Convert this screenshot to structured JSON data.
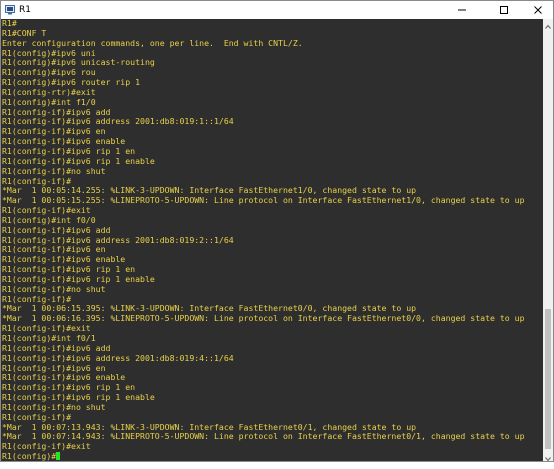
{
  "window": {
    "title": "R1"
  },
  "terminal": {
    "lines": [
      "R1#",
      "R1#CONF T",
      "Enter configuration commands, one per line.  End with CNTL/Z.",
      "R1(config)#ipv6 uni",
      "R1(config)#ipv6 unicast-routing",
      "R1(config)#ipv6 rou",
      "R1(config)#ipv6 router rip 1",
      "R1(config-rtr)#exit",
      "R1(config)#int f1/0",
      "R1(config-if)#ipv6 add",
      "R1(config-if)#ipv6 address 2001:db8:019:1::1/64",
      "R1(config-if)#ipv6 en",
      "R1(config-if)#ipv6 enable",
      "R1(config-if)#ipv6 rip 1 en",
      "R1(config-if)#ipv6 rip 1 enable",
      "R1(config-if)#no shut",
      "R1(config-if)#",
      "*Mar  1 00:05:14.255: %LINK-3-UPDOWN: Interface FastEthernet1/0, changed state to up",
      "*Mar  1 00:05:15.255: %LINEPROTO-5-UPDOWN: Line protocol on Interface FastEthernet1/0, changed state to up",
      "R1(config-if)#exit",
      "R1(config)#int f0/0",
      "R1(config-if)#ipv6 add",
      "R1(config-if)#ipv6 address 2001:db8:019:2::1/64",
      "R1(config-if)#ipv6 en",
      "R1(config-if)#ipv6 enable",
      "R1(config-if)#ipv6 rip 1 en",
      "R1(config-if)#ipv6 rip 1 enable",
      "R1(config-if)#no shut",
      "R1(config-if)#",
      "*Mar  1 00:06:15.395: %LINK-3-UPDOWN: Interface FastEthernet0/0, changed state to up",
      "*Mar  1 00:06:16.395: %LINEPROTO-5-UPDOWN: Line protocol on Interface FastEthernet0/0, changed state to up",
      "R1(config-if)#exit",
      "R1(config)#int f0/1",
      "R1(config-if)#ipv6 add",
      "R1(config-if)#ipv6 address 2001:db8:019:4::1/64",
      "R1(config-if)#ipv6 en",
      "R1(config-if)#ipv6 enable",
      "R1(config-if)#ipv6 rip 1 en",
      "R1(config-if)#ipv6 rip 1 enable",
      "R1(config-if)#no shut",
      "R1(config-if)#",
      "*Mar  1 00:07:13.943: %LINK-3-UPDOWN: Interface FastEthernet0/1, changed state to up",
      "*Mar  1 00:07:14.943: %LINEPROTO-5-UPDOWN: Line protocol on Interface FastEthernet0/1, changed state to up",
      "R1(config-if)#exit"
    ],
    "prompt": "R1(config)#"
  },
  "colors": {
    "terminal_bg": "#2e2e2e",
    "text": "#e8d14a",
    "cursor": "#22e622"
  },
  "icons": {
    "app": "terminal-icon",
    "minimize": "minimize-icon",
    "maximize": "maximize-icon",
    "close": "close-icon"
  }
}
